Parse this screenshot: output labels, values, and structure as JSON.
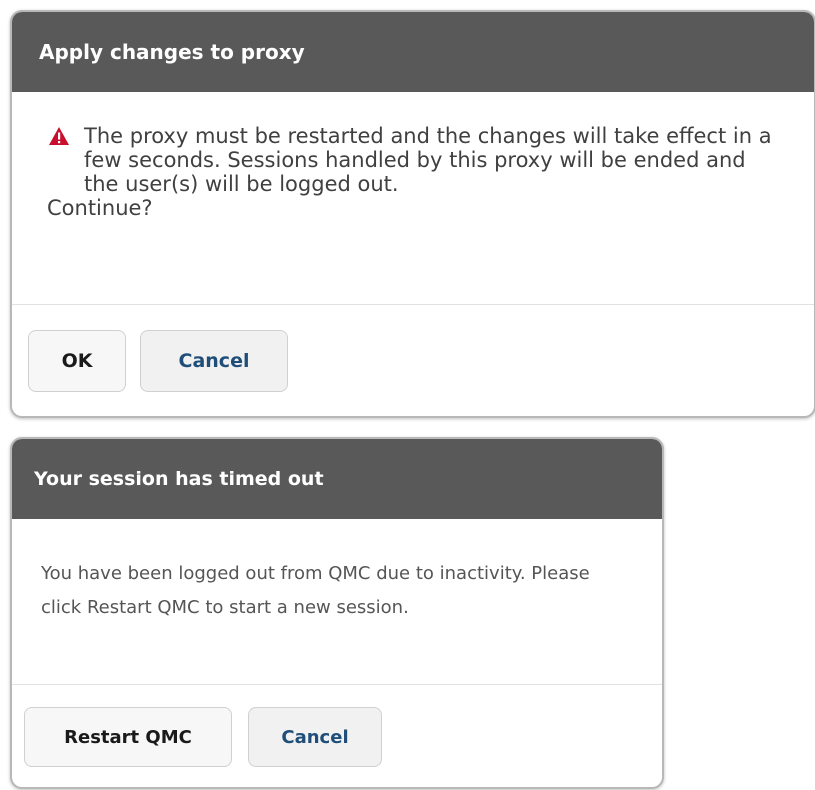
{
  "dialogs": {
    "proxy": {
      "title": "Apply changes to proxy",
      "warning_icon": "warning-triangle-icon",
      "warning_color": "#c8102e",
      "message": "The proxy must be restarted and the changes will take effect in a few seconds. Sessions handled by this proxy will be ended and the user(s) will be logged out.",
      "prompt": "Continue?",
      "ok_label": "OK",
      "cancel_label": "Cancel"
    },
    "timeout": {
      "title": "Your session has timed out",
      "message": "You have been logged out from QMC due to inactivity. Please click Restart QMC to start a new session.",
      "restart_label": "Restart QMC",
      "cancel_label": "Cancel"
    }
  },
  "colors": {
    "header_bg": "#595959",
    "header_text": "#ffffff",
    "cancel_text": "#1f4e79"
  }
}
